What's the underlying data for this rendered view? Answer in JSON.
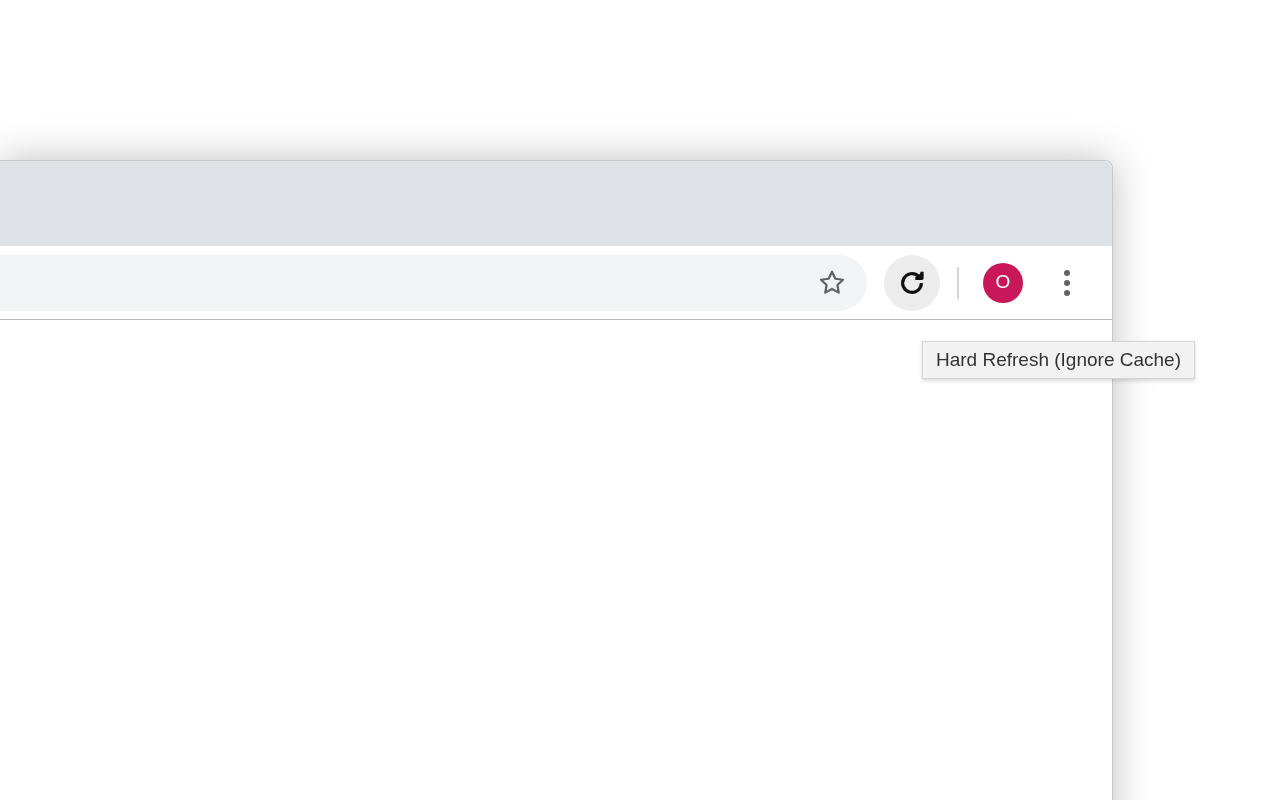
{
  "toolbar": {
    "reload_button": {
      "hovered": true
    },
    "profile": {
      "label": "O",
      "color": "#c8185a"
    }
  },
  "tooltip": {
    "text": "Hard Refresh (Ignore Cache)"
  }
}
